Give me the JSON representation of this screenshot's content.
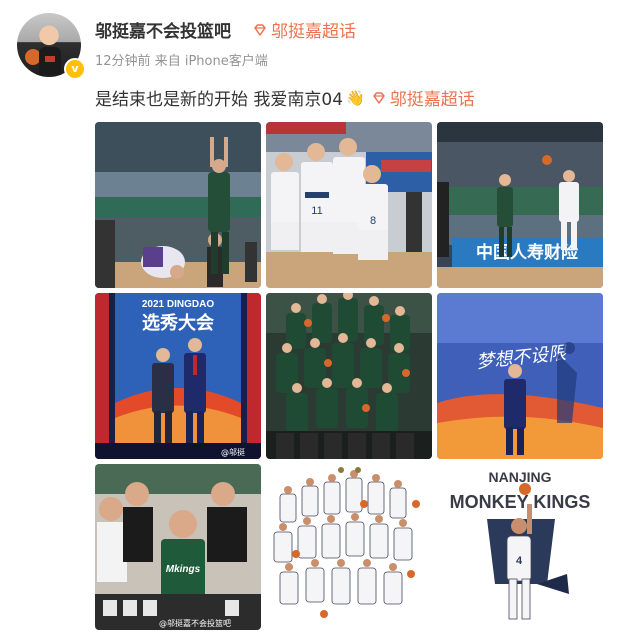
{
  "post": {
    "username": "邬挺嘉不会投篮吧",
    "topic_label": "邬挺嘉超话",
    "time": "12分钟前",
    "source_prefix": "来自",
    "source_device": "iPhone客户端",
    "text": "是结束也是新的开始 我爱南京04",
    "emoji": "👋",
    "inline_topic": "邬挺嘉超话"
  },
  "images": {
    "img2_numbers": [
      "11",
      "8"
    ],
    "img3_banner": "中国人寿财险",
    "img4_title": "2021 DINGDAO",
    "img4_banner": "选秀大会",
    "img4_watermark": "@邬挺",
    "img6_text": "梦想不设限",
    "img7_jersey": "Mkings",
    "img7_watermark": "@邬挺嘉不会投篮吧",
    "img9_city": "NANJING",
    "img9_team": "MONKEY KINGS",
    "img9_number": "4"
  },
  "colors": {
    "topic": "#eb7350",
    "muted": "#939393",
    "text": "#333333",
    "verified": "#ffc107"
  }
}
